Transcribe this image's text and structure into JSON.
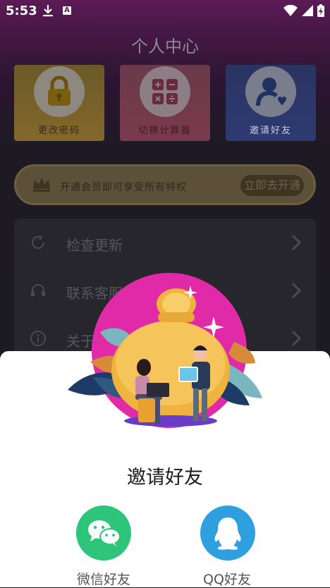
{
  "status": {
    "time": "5:53",
    "a_badge": "A"
  },
  "header": {
    "title": "个人中心"
  },
  "tiles": [
    {
      "label": "更改密码",
      "icon": "lock-icon"
    },
    {
      "label": "切换计算器",
      "icon": "calculator-icon"
    },
    {
      "label": "邀请好友",
      "icon": "invite-user-icon"
    }
  ],
  "vip": {
    "text": "开通会员即可享受所有特权",
    "button": "立即去开通",
    "icon": "crown-icon"
  },
  "menu": [
    {
      "label": "检查更新",
      "icon": "refresh-icon"
    },
    {
      "label": "联系客服",
      "icon": "headset-icon"
    },
    {
      "label": "关于我们",
      "icon": "info-icon"
    }
  ],
  "share_sheet": {
    "title": "邀请好友",
    "options": [
      {
        "label": "微信好友",
        "icon": "wechat-icon",
        "color": "#2ec47a"
      },
      {
        "label": "QQ好友",
        "icon": "qq-icon",
        "color": "#2e9fdf"
      }
    ]
  }
}
